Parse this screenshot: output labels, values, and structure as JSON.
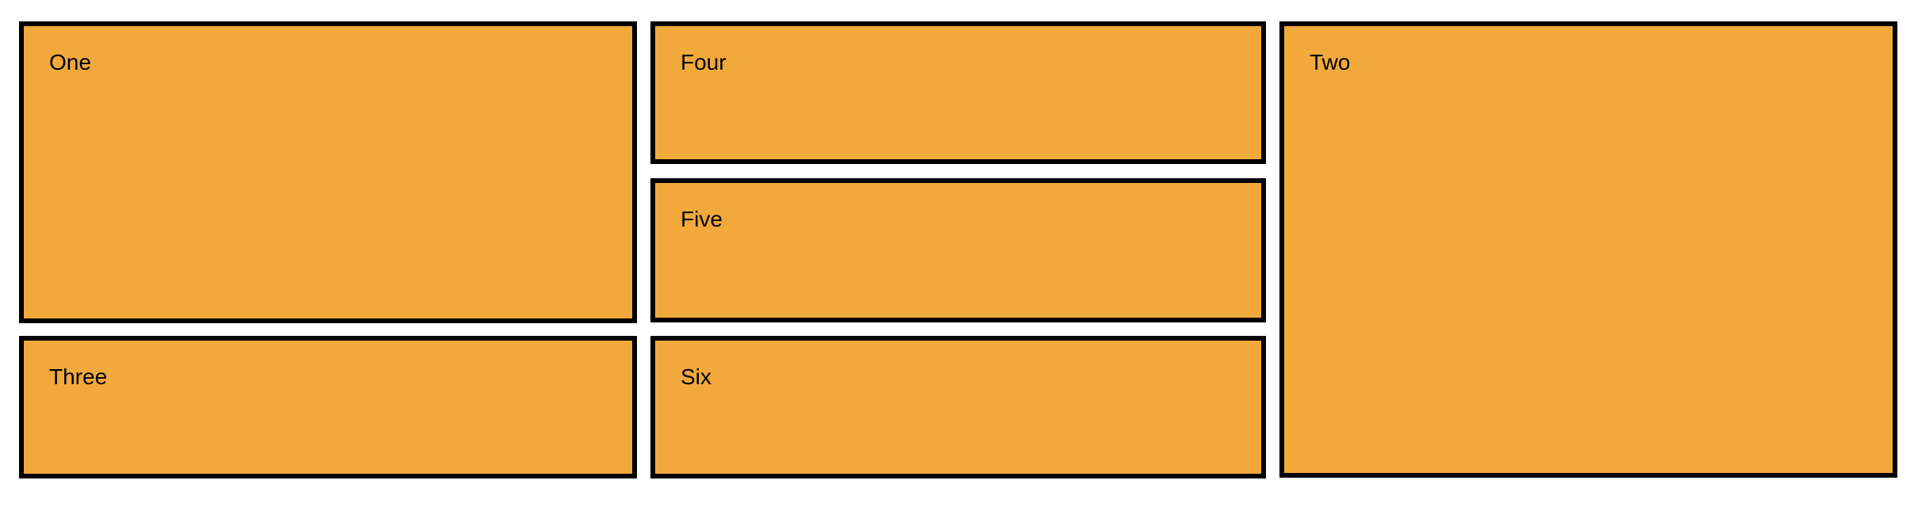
{
  "colors": {
    "box_fill": "#f2a93b",
    "box_border": "#000000",
    "text": "#000000",
    "page_background": "#ffffff"
  },
  "boxes": {
    "one": "One",
    "two": "Two",
    "three": "Three",
    "four": "Four",
    "five": "Five",
    "six": "Six"
  }
}
